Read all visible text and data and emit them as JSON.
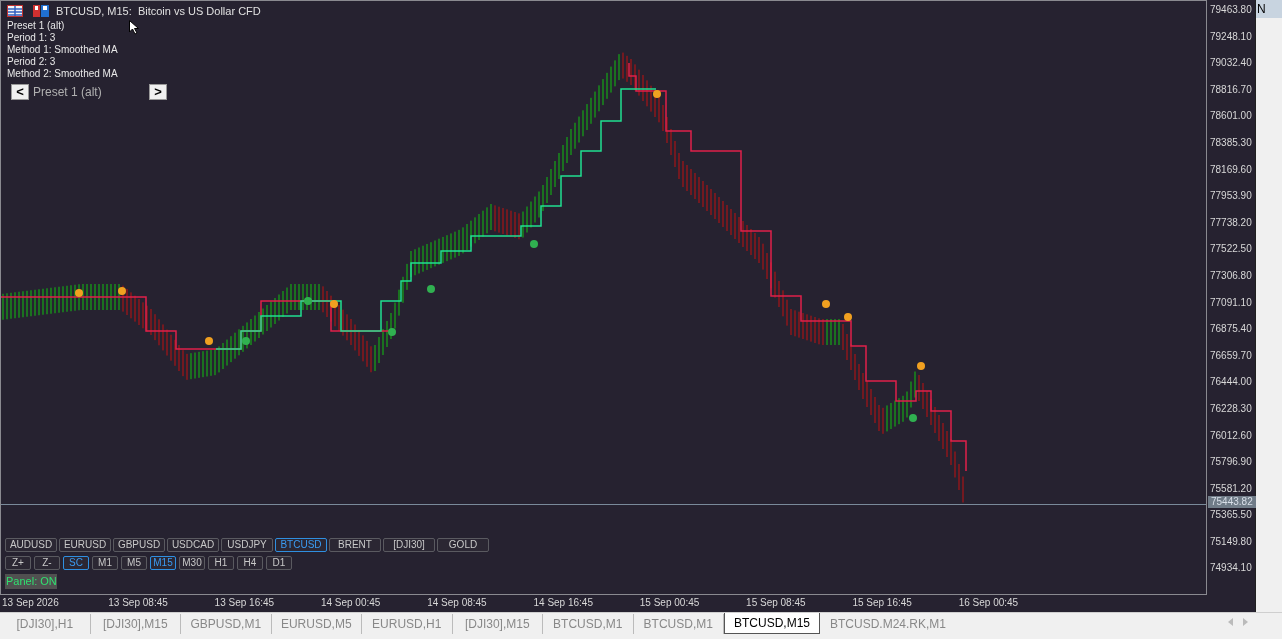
{
  "window": {
    "title": "BTCUSD, M15:  Bitcoin vs US Dollar CFD"
  },
  "info_lines": [
    "Preset 1 (alt)",
    "Period 1: 3",
    "Method 1: Smoothed MA",
    "Period 2: 3",
    "Method 2: Smoothed MA"
  ],
  "preset_nav": {
    "prev": "<",
    "label": "Preset 1 (alt)",
    "next": ">"
  },
  "symbol_buttons": [
    {
      "label": "AUDUSD",
      "selected": false
    },
    {
      "label": "EURUSD",
      "selected": false
    },
    {
      "label": "GBPUSD",
      "selected": false
    },
    {
      "label": "USDCAD",
      "selected": false
    },
    {
      "label": "USDJPY",
      "selected": false
    },
    {
      "label": "BTCUSD",
      "selected": true
    },
    {
      "label": "BRENT",
      "selected": false
    },
    {
      "label": "[DJI30]",
      "selected": false
    },
    {
      "label": "GOLD",
      "selected": false
    }
  ],
  "timeframe_buttons": [
    {
      "label": "Z+",
      "selected": false
    },
    {
      "label": "Z-",
      "selected": false
    },
    {
      "label": "SC",
      "selected": true
    },
    {
      "label": "M1",
      "selected": false
    },
    {
      "label": "M5",
      "selected": false
    },
    {
      "label": "M15",
      "selected": true
    },
    {
      "label": "M30",
      "selected": false
    },
    {
      "label": "H1",
      "selected": false
    },
    {
      "label": "H4",
      "selected": false
    },
    {
      "label": "D1",
      "selected": false
    }
  ],
  "panel_toggle": {
    "label": "Panel: ON",
    "on": true
  },
  "price_axis": {
    "labels": [
      "79463.80",
      "79248.10",
      "79032.40",
      "78816.70",
      "78601.00",
      "78385.30",
      "78169.60",
      "77953.90",
      "77738.20",
      "77522.50",
      "77306.80",
      "77091.10",
      "76875.40",
      "76659.70",
      "76444.00",
      "76228.30",
      "76012.60",
      "75796.90",
      "75581.20",
      "75365.50",
      "75149.80",
      "74934.10"
    ],
    "current_price": "75443.82"
  },
  "time_axis": {
    "labels": [
      "13 Sep 2026",
      "13 Sep 08:45",
      "13 Sep 16:45",
      "14 Sep 00:45",
      "14 Sep 08:45",
      "14 Sep 16:45",
      "15 Sep 00:45",
      "15 Sep 08:45",
      "15 Sep 16:45",
      "16 Sep 00:45"
    ]
  },
  "tabs": [
    {
      "label": "[DJI30],H1",
      "selected": false
    },
    {
      "label": "[DJI30],M15",
      "selected": false
    },
    {
      "label": "GBPUSD,M1",
      "selected": false
    },
    {
      "label": "EURUSD,M5",
      "selected": false
    },
    {
      "label": "EURUSD,H1",
      "selected": false
    },
    {
      "label": "[DJI30],M15",
      "selected": false
    },
    {
      "label": "BTCUSD,M1",
      "selected": false
    },
    {
      "label": "BTCUSD,M1",
      "selected": false
    },
    {
      "label": "BTCUSD,M15",
      "selected": true
    },
    {
      "label": "BTCUSD.M24.RK,M1",
      "selected": false
    }
  ],
  "side_panel": {
    "header": "N"
  }
}
